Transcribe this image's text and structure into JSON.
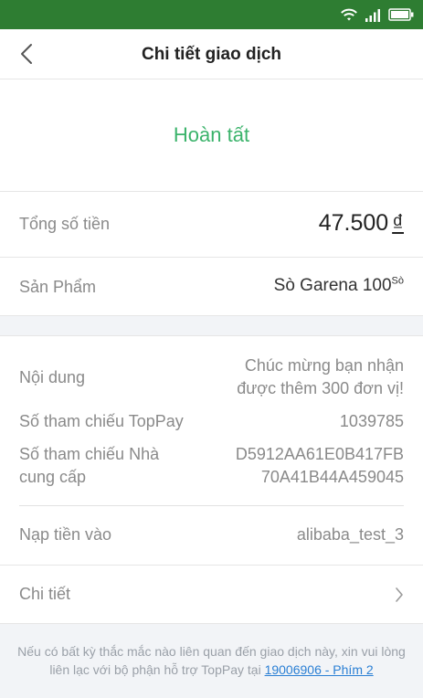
{
  "header": {
    "title": "Chi tiết giao dịch"
  },
  "status": {
    "text": "Hoàn tất"
  },
  "summary": {
    "total_label": "Tổng số tiền",
    "total_amount": "47.500",
    "currency": "₫",
    "product_label": "Sản Phẩm",
    "product_name": "Sò Garena 100",
    "product_unit": "Sò"
  },
  "details": {
    "content_label": "Nội dung",
    "content_line1": "Chúc mừng bạn nhận",
    "content_line2": "được thêm 300 đơn vị!",
    "ref_label": "Số tham chiếu TopPay",
    "ref_value": "1039785",
    "provider_ref_label_line1": "Số tham chiếu Nhà",
    "provider_ref_label_line2": "cung cấp",
    "provider_ref_line1": "D5912AA61E0B417FB",
    "provider_ref_line2": "70A41B44A459045",
    "topup_label": "Nạp tiền vào",
    "topup_value": "alibaba_test_3",
    "more_label": "Chi tiết"
  },
  "footer": {
    "text": "Nếu có bất kỳ thắc mắc nào liên quan đến giao dịch này, xin vui lòng liên lạc với bộ phận hỗ trợ TopPay tại",
    "link": "19006906 - Phím 2"
  },
  "colors": {
    "statusbar": "#2e7d32",
    "success": "#3bb36b",
    "link": "#2a7fd4"
  },
  "icons": [
    "wifi-icon",
    "signal-icon",
    "battery-icon",
    "back-arrow-icon",
    "chevron-right-icon"
  ]
}
